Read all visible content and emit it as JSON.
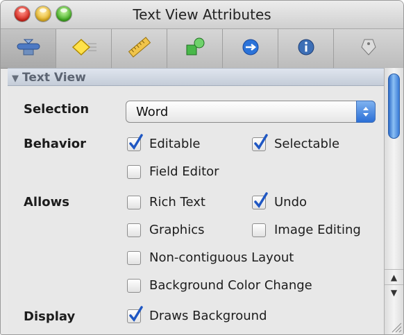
{
  "window": {
    "title": "Text View Attributes"
  },
  "toolbar": {
    "tabs": [
      {
        "icon": "attributes-icon",
        "selected": true
      },
      {
        "icon": "effects-icon",
        "selected": false
      },
      {
        "icon": "size-ruler-icon",
        "selected": false
      },
      {
        "icon": "bindings-icon",
        "selected": false
      },
      {
        "icon": "connections-icon",
        "selected": false
      },
      {
        "icon": "info-icon",
        "selected": false
      },
      {
        "icon": "identity-icon",
        "selected": false
      }
    ]
  },
  "section": {
    "title": "Text View"
  },
  "selection": {
    "label": "Selection",
    "value": "Word"
  },
  "behavior": {
    "label": "Behavior",
    "editable": {
      "label": "Editable",
      "checked": true
    },
    "selectable": {
      "label": "Selectable",
      "checked": true
    },
    "field_editor": {
      "label": "Field Editor",
      "checked": false
    }
  },
  "allows": {
    "label": "Allows",
    "rich_text": {
      "label": "Rich Text",
      "checked": false
    },
    "undo": {
      "label": "Undo",
      "checked": true
    },
    "graphics": {
      "label": "Graphics",
      "checked": false
    },
    "image_editing": {
      "label": "Image Editing",
      "checked": false
    },
    "non_contiguous_layout": {
      "label": "Non-contiguous Layout",
      "checked": false
    },
    "background_color_change": {
      "label": "Background Color Change",
      "checked": false
    }
  },
  "display": {
    "label": "Display",
    "draws_background": {
      "label": "Draws Background",
      "checked": true
    }
  },
  "colors": {
    "accent": "#2b6fd6",
    "checkmark": "#1f57c3"
  }
}
